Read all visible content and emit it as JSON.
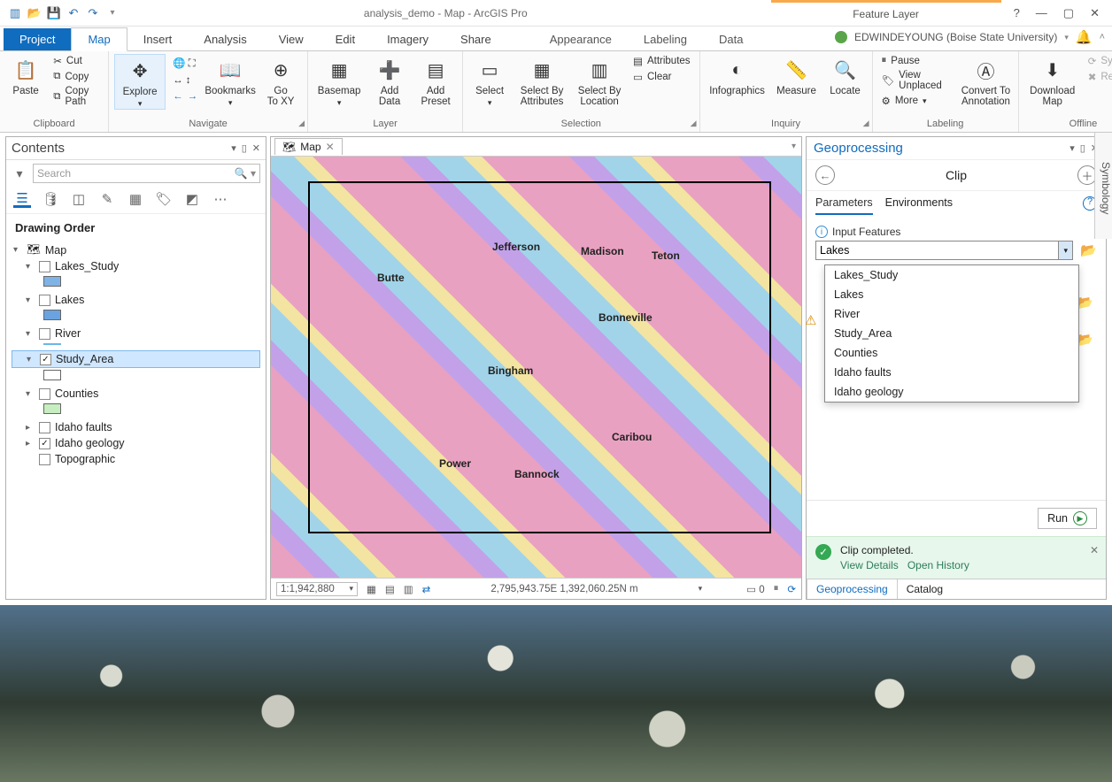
{
  "title": "analysis_demo - Map - ArcGIS Pro",
  "context_tab": "Feature Layer",
  "user": "EDWINDEYOUNG (Boise State University)",
  "ribbon_tabs": {
    "file": "Project",
    "items": [
      "Map",
      "Insert",
      "Analysis",
      "View",
      "Edit",
      "Imagery",
      "Share"
    ],
    "context_items": [
      "Appearance",
      "Labeling",
      "Data"
    ],
    "active": "Map"
  },
  "ribbon": {
    "clipboard": {
      "label": "Clipboard",
      "paste": "Paste",
      "cut": "Cut",
      "copy": "Copy",
      "copypath": "Copy Path"
    },
    "navigate": {
      "label": "Navigate",
      "explore": "Explore",
      "bookmarks": "Bookmarks",
      "goto": "Go\nTo XY"
    },
    "layer": {
      "label": "Layer",
      "basemap": "Basemap",
      "adddata": "Add\nData",
      "addpreset": "Add\nPreset"
    },
    "selection": {
      "label": "Selection",
      "select": "Select",
      "byattr": "Select By\nAttributes",
      "byloc": "Select By\nLocation",
      "attrs": "Attributes",
      "clear": "Clear"
    },
    "inquiry": {
      "label": "Inquiry",
      "info": "Infographics",
      "measure": "Measure",
      "locate": "Locate"
    },
    "labeling": {
      "label": "Labeling",
      "pause": "Pause",
      "unplaced": "View Unplaced",
      "more": "More",
      "convert": "Convert To\nAnnotation"
    },
    "offline": {
      "label": "Offline",
      "download": "Download\nMap",
      "sync": "Sync",
      "remove": "Remove"
    }
  },
  "contents": {
    "title": "Contents",
    "search_placeholder": "Search",
    "drawing_order": "Drawing Order",
    "root": "Map",
    "layers": [
      {
        "name": "Lakes_Study",
        "checked": false,
        "swatch": "#7fb3e6"
      },
      {
        "name": "Lakes",
        "checked": false,
        "swatch": "#6aa3e0"
      },
      {
        "name": "River",
        "checked": false,
        "swatch": "#6ab7e8",
        "line": true
      },
      {
        "name": "Study_Area",
        "checked": true,
        "swatch": "#ffffff",
        "selected": true
      },
      {
        "name": "Counties",
        "checked": false,
        "swatch": "#c7eec0"
      },
      {
        "name": "Idaho faults",
        "checked": false,
        "collapsed": true
      },
      {
        "name": "Idaho geology",
        "checked": true,
        "collapsed": true
      },
      {
        "name": "Topographic",
        "checked": false,
        "noarrow": true
      }
    ]
  },
  "map": {
    "tab": "Map",
    "labels": [
      "Butte",
      "Jefferson",
      "Madison",
      "Teton",
      "Bingham",
      "Bonneville",
      "Power",
      "Bannock",
      "Caribou"
    ],
    "scale": "1:1,942,880",
    "coords": "2,795,943.75E 1,392,060.25N m",
    "sel_count": "0"
  },
  "geo": {
    "title": "Geoprocessing",
    "tool": "Clip",
    "tabs": {
      "params": "Parameters",
      "env": "Environments"
    },
    "input_label": "Input Features",
    "input_value": "Lakes",
    "options": [
      "Lakes_Study",
      "Lakes",
      "River",
      "Study_Area",
      "Counties",
      "Idaho faults",
      "Idaho geology"
    ],
    "run": "Run",
    "msg": {
      "title": "Clip completed.",
      "details": "View Details",
      "history": "Open History"
    },
    "bottom_tabs": {
      "gp": "Geoprocessing",
      "cat": "Catalog"
    },
    "help_tip": "?"
  },
  "symbology": "Symbology"
}
